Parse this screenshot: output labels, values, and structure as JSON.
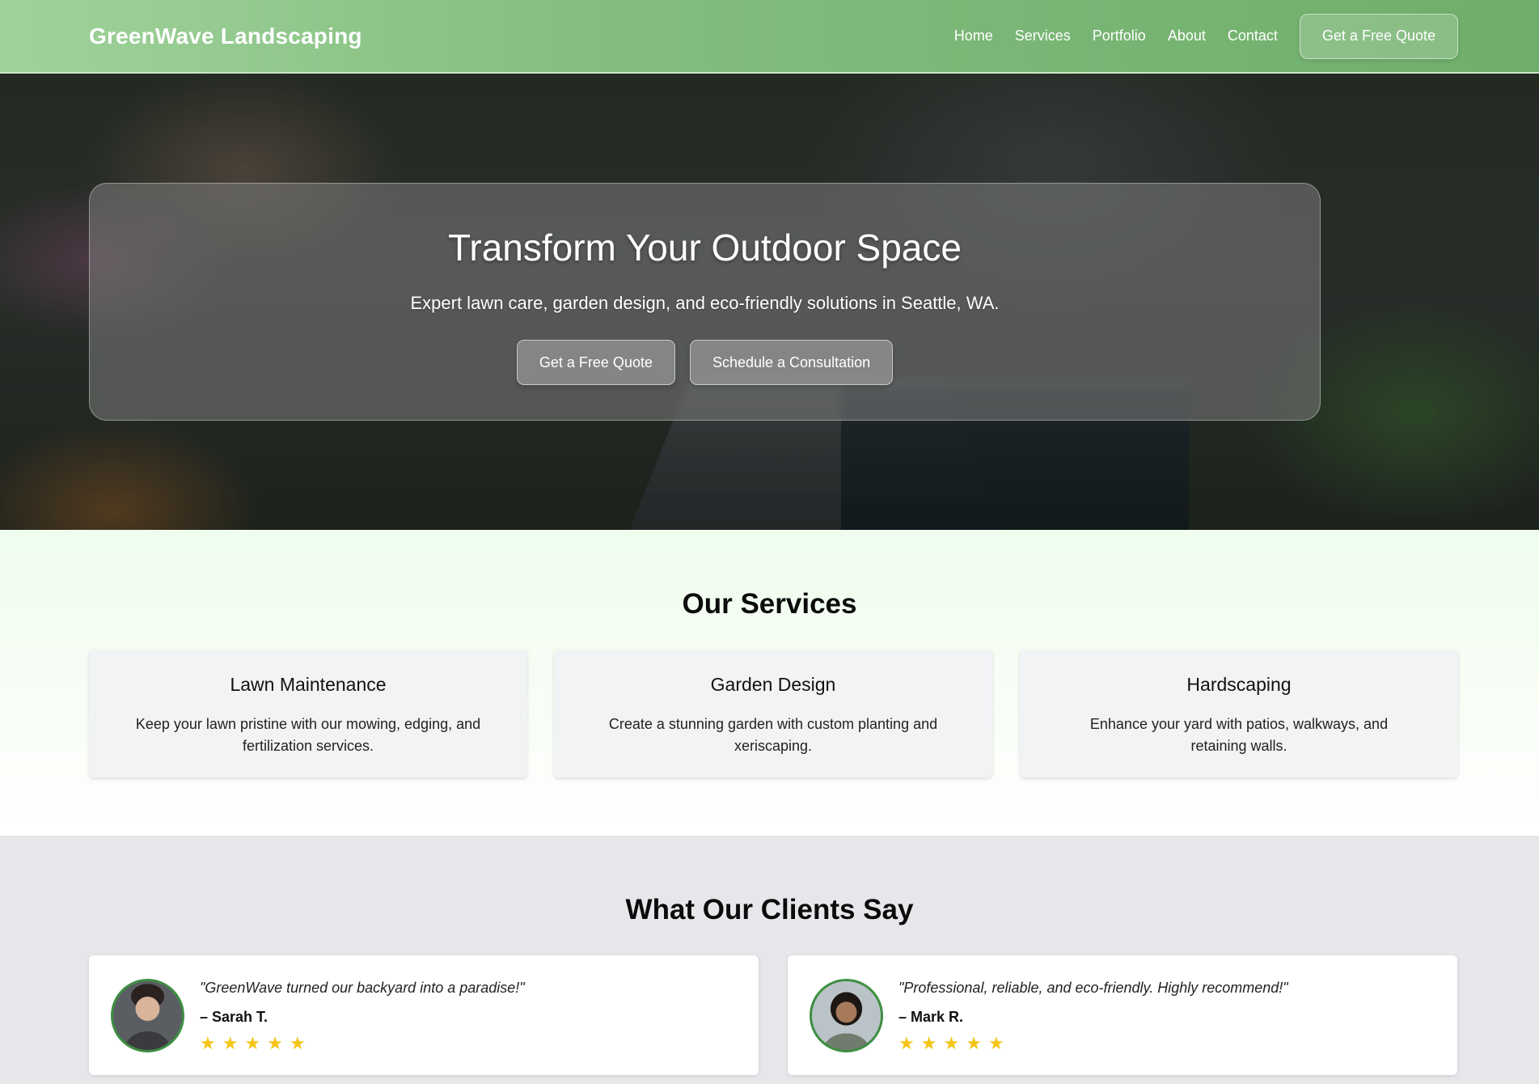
{
  "header": {
    "brand": "GreenWave Landscaping",
    "nav": [
      "Home",
      "Services",
      "Portfolio",
      "About",
      "Contact"
    ],
    "cta": "Get a Free Quote"
  },
  "hero": {
    "title": "Transform Your Outdoor Space",
    "subtitle": "Expert lawn care, garden design, and eco-friendly solutions in Seattle, WA.",
    "primary_button": "Get a Free Quote",
    "secondary_button": "Schedule a Consultation"
  },
  "services": {
    "title": "Our Services",
    "items": [
      {
        "title": "Lawn Maintenance",
        "description": "Keep your lawn pristine with our mowing, edging, and fertilization services."
      },
      {
        "title": "Garden Design",
        "description": "Create a stunning garden with custom planting and xeriscaping."
      },
      {
        "title": "Hardscaping",
        "description": "Enhance your yard with patios, walkways, and retaining walls."
      }
    ]
  },
  "testimonials": {
    "title": "What Our Clients Say",
    "items": [
      {
        "quote": "\"GreenWave turned our backyard into a paradise!\"",
        "author": "– Sarah T.",
        "stars": "★ ★ ★ ★ ★",
        "rating": 5
      },
      {
        "quote": "\"Professional, reliable, and eco-friendly. Highly recommend!\"",
        "author": "– Mark R.",
        "stars": "★ ★ ★ ★ ★",
        "rating": 5
      }
    ]
  },
  "colors": {
    "header_green": "#82bd7e",
    "avatar_border": "#3e8e41",
    "star_gold": "#f5c518"
  }
}
